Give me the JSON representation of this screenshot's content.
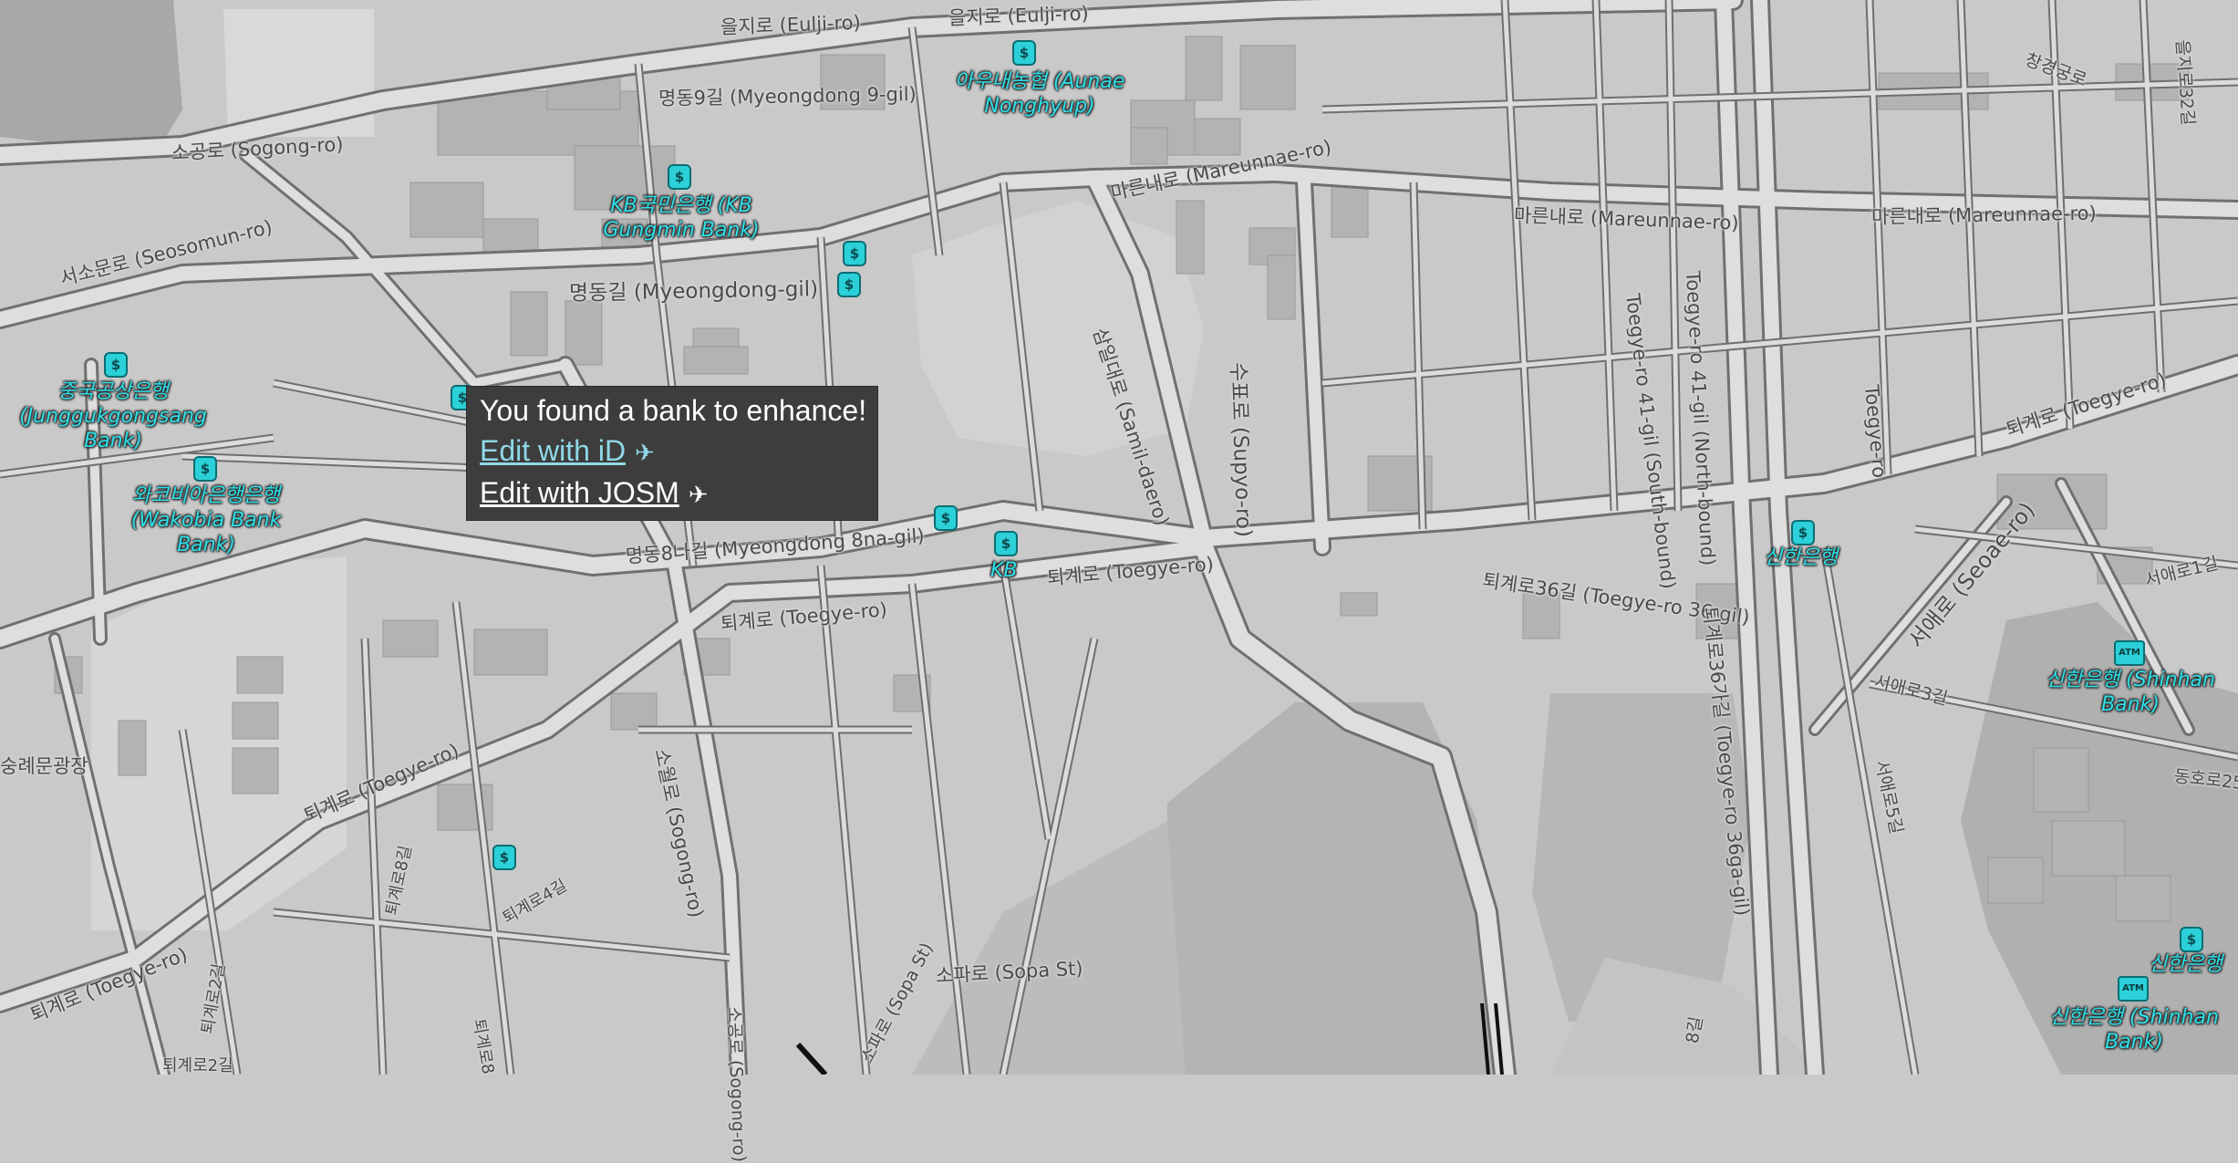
{
  "popup": {
    "title": "You found a bank to enhance!",
    "edit_id": "Edit with iD",
    "edit_josm": "Edit with JOSM",
    "edit_icon": "✈"
  },
  "roads": {
    "eulji1": "을지로 (Eulji-ro)",
    "eulji2": "을지로 (Eulji-ro)",
    "sogong": "소공로 (Sogong-ro)",
    "myeongdong9": "명동9길 (Myeongdong 9-gil)",
    "seosomun": "서소문로 (Seosomun-ro)",
    "myeongdong": "명동길 (Myeongdong-gil)",
    "mareunnae1": "마른내로 (Mareunnae-ro)",
    "mareunnae2": "마른내로 (Mareunnae-ro)",
    "mareunnae3": "마른내로 (Mareunnae-ro)",
    "samil": "삼일대로 (Samil-daero)",
    "supyo": "수표로 (Supyo-ro)",
    "toegye41": "Toegye-ro 41-gil (South-bound)",
    "toegye41n": "Toegye-ro 41-gil (North-bound)",
    "toegyero_v": "Toegye-ro",
    "toegye_right": "퇴계로 (Toegye-ro)",
    "seoae": "서애로 (Seoae-ro)",
    "myeongdong8na": "명동8나길 (Myeongdong 8na-gil)",
    "toegye_center": "퇴계로 (Toegye-ro)",
    "toegye_mid": "퇴계로 (Toegye-ro)",
    "toegye36": "퇴계로36길 (Toegye-ro 36-gil)",
    "toegye36ga": "퇴계로36가길 (Toegye-ro 36ga-gil)",
    "toegye_sw": "퇴계로 (Toegye-ro)",
    "toegye_far_sw": "퇴계로 (Toegye-ro)",
    "soweol": "소월로 (Sogong-ro)",
    "toegye8": "퇴계로8길",
    "toegye4": "퇴계로4길",
    "toegye2a": "퇴계로2길",
    "toegye2b": "퇴계로2길",
    "sopa": "소파로 (Sopa St)",
    "sopa2": "소파로 (Sopa St)",
    "sungnye": "숭례문광장",
    "seoae3": "서애로3길",
    "seoae5": "서애로5길",
    "seoae1": "서애로1길",
    "dongho25": "동호로25",
    "changgyeong": "창경궁로",
    "eulji32": "을지로32길",
    "toegye8b": "퇴계로8",
    "sogong_s": "소공로 (Sogong-ro)",
    "gil8": "8길"
  },
  "pois": {
    "aunae": "아우내농협 (Aunae Nonghyup)",
    "kb_gungmin": "KB국민은행 (KB Gungmin Bank)",
    "junggukgongsang": "중국공상은행 (Junggukgongsang Bank)",
    "wakobia": "와코비아은행은행 (Wakobia Bank Bank)",
    "kb": "KB",
    "shinhan1": "신한은행",
    "shinhan_bank1": "신한은행 (Shinhan Bank)",
    "shinhan2": "신한은행",
    "shinhan_bank2": "신한은행 (Shinhan Bank)",
    "bank_icon": "$",
    "atm_icon": "ATM"
  },
  "colors": {
    "background": "#c9c9c9",
    "road": "#dcdcdc",
    "road_casing": "#6e6e6e",
    "building": "#b0b0b0",
    "poi": "#2bd0d8",
    "popup_bg": "#3d3d3d",
    "link_id": "#8fd8e6"
  }
}
